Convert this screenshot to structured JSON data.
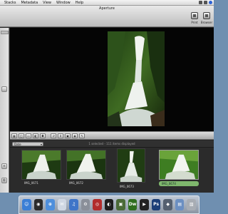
{
  "menubar": {
    "items": [
      "Stacks",
      "Metadata",
      "View",
      "Window",
      "Help"
    ]
  },
  "window": {
    "title": "Aperture"
  },
  "toolbar": {
    "print_label": "Print",
    "browser_label": "Browser"
  },
  "browser": {
    "sort_field": "Date",
    "selection_status": "1 selected - 111 items displayed",
    "thumbnails": [
      {
        "caption": "IMG_0671",
        "selected": false
      },
      {
        "caption": "IMG_0672",
        "selected": false
      },
      {
        "caption": "IMG_0673",
        "selected": false
      },
      {
        "caption": "IMG_0674",
        "selected": true
      }
    ]
  },
  "dock": {
    "apps": [
      {
        "name": "finder-icon",
        "glyph": "☺",
        "color": "#3b7fd6"
      },
      {
        "name": "dashboard-icon",
        "glyph": "◉",
        "color": "#2b2b2b"
      },
      {
        "name": "safari-icon",
        "glyph": "⊕",
        "color": "#4e8fdc"
      },
      {
        "name": "mail-icon",
        "glyph": "✉",
        "color": "#cfd7e3"
      },
      {
        "name": "itunes-icon",
        "glyph": "♫",
        "color": "#3f75c8"
      },
      {
        "name": "system-preferences-icon",
        "glyph": "⚙",
        "color": "#8a8f99"
      },
      {
        "name": "photo-booth-icon",
        "glyph": "◎",
        "color": "#b22c2c"
      },
      {
        "name": "aperture-icon",
        "glyph": "◐",
        "color": "#1d1d1d"
      },
      {
        "name": "photo-app-icon",
        "glyph": "▣",
        "color": "#4b6b38"
      },
      {
        "name": "dreamweaver-icon",
        "glyph": "Dw",
        "color": "#2f6e1f"
      },
      {
        "name": "movie-icon",
        "glyph": "▶",
        "color": "#222222"
      },
      {
        "name": "photoshop-icon",
        "glyph": "Ps",
        "color": "#1d3f78"
      },
      {
        "name": "app-icon",
        "glyph": "◆",
        "color": "#556070"
      },
      {
        "name": "folder-icon",
        "glyph": "▤",
        "color": "#6b8fc2"
      },
      {
        "name": "trash-icon",
        "glyph": "▥",
        "color": "#a8adb4"
      }
    ]
  }
}
